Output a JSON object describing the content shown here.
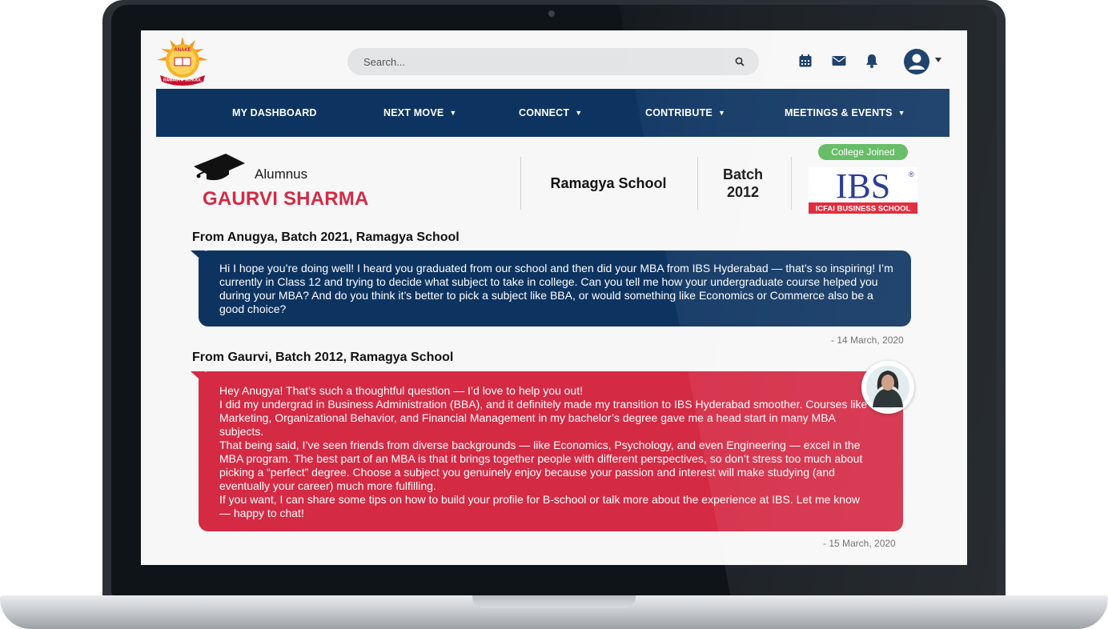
{
  "header": {
    "logo_label": "RAMAGYA SCHOOL",
    "logo_top_text": "ANAKE",
    "search": {
      "placeholder": "Search..."
    },
    "icons": [
      "calendar-icon",
      "mail-icon",
      "bell-icon",
      "user-icon",
      "caret-down-icon"
    ]
  },
  "nav": {
    "items": [
      {
        "label": "MY DASHBOARD",
        "dropdown": false
      },
      {
        "label": "NEXT MOVE",
        "dropdown": true
      },
      {
        "label": "CONNECT",
        "dropdown": true
      },
      {
        "label": "CONTRIBUTE",
        "dropdown": true
      },
      {
        "label": "MEETINGS & EVENTS",
        "dropdown": true
      }
    ],
    "dropdown_glyph": "▼"
  },
  "profile": {
    "role": "Alumnus",
    "name": "GAURVI SHARMA",
    "school": "Ramagya School",
    "batch_label": "Batch",
    "batch_year": "2012",
    "college_badge": "College Joined",
    "college_logo_text": "IBS",
    "college_logo_subtext": "ICFAI BUSINESS SCHOOL",
    "college_logo_mark": "®"
  },
  "messages": [
    {
      "from": "From Anugya, Batch 2021, Ramagya School",
      "lines": [
        "Hi I hope you’re doing well! I heard you graduated from our school and then did your MBA from IBS Hyderabad — that’s so inspiring! I’m currently in Class 12 and trying to decide what subject to take in college. Can you tell me how your undergraduate course helped you during your MBA? And do you think it’s better to pick a subject like BBA, or would something like Economics or Commerce also be a good choice?"
      ],
      "date": "- 14 March, 2020"
    },
    {
      "from": "From Gaurvi, Batch 2012, Ramagya School",
      "lines": [
        "Hey Anugya! That’s such a thoughtful question — I’d love to help you out!",
        "I did my undergrad in Business Administration (BBA), and it definitely made my transition to IBS Hyderabad smoother. Courses like Marketing, Organizational Behavior, and Financial Management in my bachelor’s degree gave me a head start in many MBA subjects.",
        "That being said, I’ve seen friends from diverse backgrounds — like Economics, Psychology, and even Engineering — excel in the MBA program. The best part of an MBA is that it brings together people with different perspectives, so don’t stress too much about picking a “perfect” degree. Choose a subject you genuinely enjoy because your passion and interest will make studying (and eventually your career) much more fulfilling.",
        "If you want, I can share some tips on how to build your profile for B-school or talk more about the experience at IBS. Let me know — happy to chat!"
      ],
      "date": "- 15 March, 2020"
    }
  ],
  "colors": {
    "navy": "#0d3461",
    "crimson": "#d42a44",
    "badge_green": "#5cb85c",
    "ibs_blue": "#1c2e8c",
    "ibs_red": "#e01b2f"
  }
}
